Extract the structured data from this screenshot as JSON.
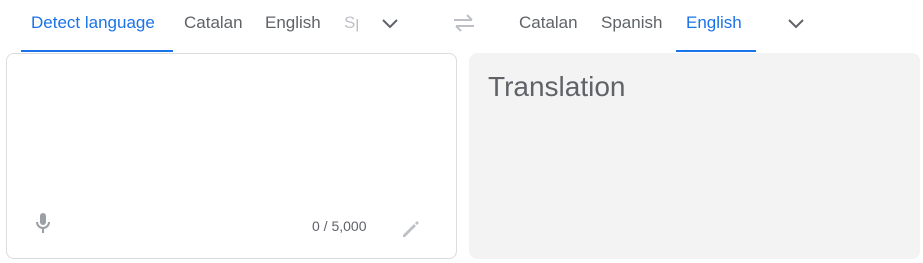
{
  "source_tabs": {
    "items": [
      {
        "label": "Detect language",
        "active": true
      },
      {
        "label": "Catalan",
        "active": false
      },
      {
        "label": "English",
        "active": false
      },
      {
        "label": "Sp",
        "active": false
      }
    ]
  },
  "target_tabs": {
    "items": [
      {
        "label": "Catalan",
        "active": false
      },
      {
        "label": "Spanish",
        "active": false
      },
      {
        "label": "English",
        "active": true
      }
    ]
  },
  "source_panel": {
    "placeholder": "",
    "char_count": "0 / 5,000",
    "mic_icon": "mic-icon",
    "edit_icon": "pencil-icon"
  },
  "target_panel": {
    "placeholder": "Translation"
  },
  "colors": {
    "accent": "#1a73e8",
    "text_secondary": "#5f6368",
    "panel_bg": "#f3f3f3",
    "border": "#dadce0"
  }
}
